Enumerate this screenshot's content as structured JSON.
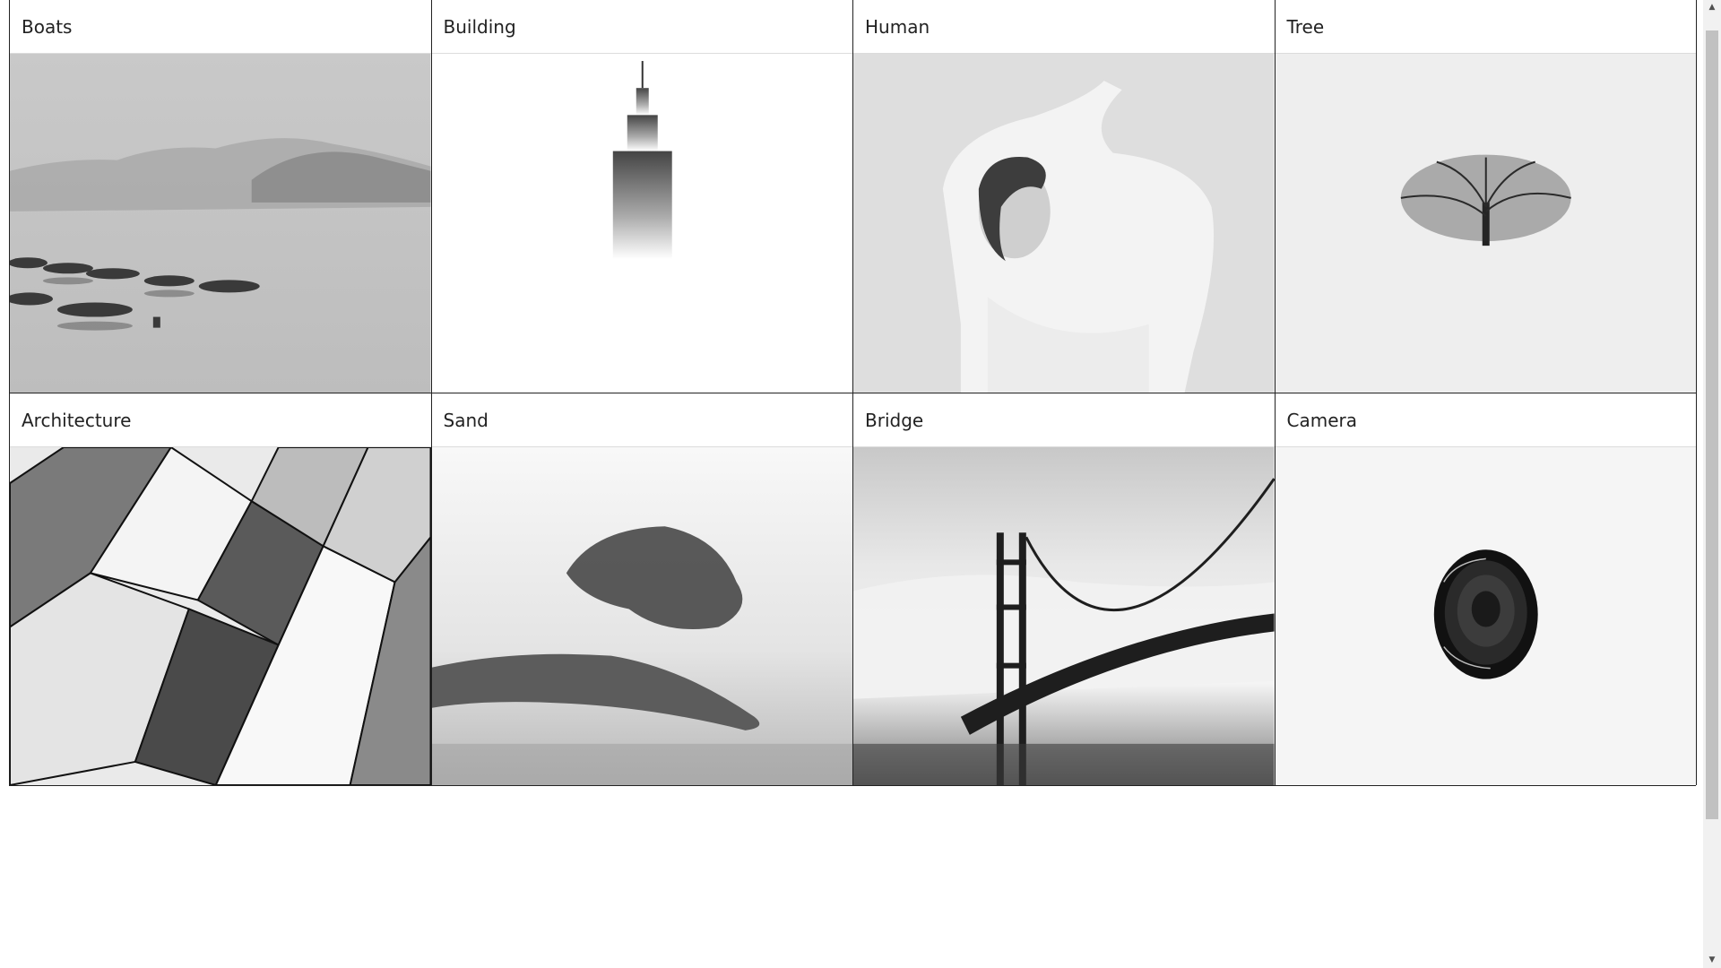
{
  "gallery": {
    "cards": [
      {
        "title": "Boats",
        "image": "boats-on-misty-lake-image"
      },
      {
        "title": "Building",
        "image": "skyscraper-in-fog-image"
      },
      {
        "title": "Human",
        "image": "woman-portrait-image"
      },
      {
        "title": "Tree",
        "image": "lone-tree-image"
      },
      {
        "title": "Architecture",
        "image": "geometric-facade-image"
      },
      {
        "title": "Sand",
        "image": "sand-over-hand-image"
      },
      {
        "title": "Bridge",
        "image": "golden-gate-bridge-image"
      },
      {
        "title": "Camera",
        "image": "camera-lens-image"
      }
    ]
  },
  "scrollbar": {
    "up_icon": "▲",
    "down_icon": "▼"
  }
}
